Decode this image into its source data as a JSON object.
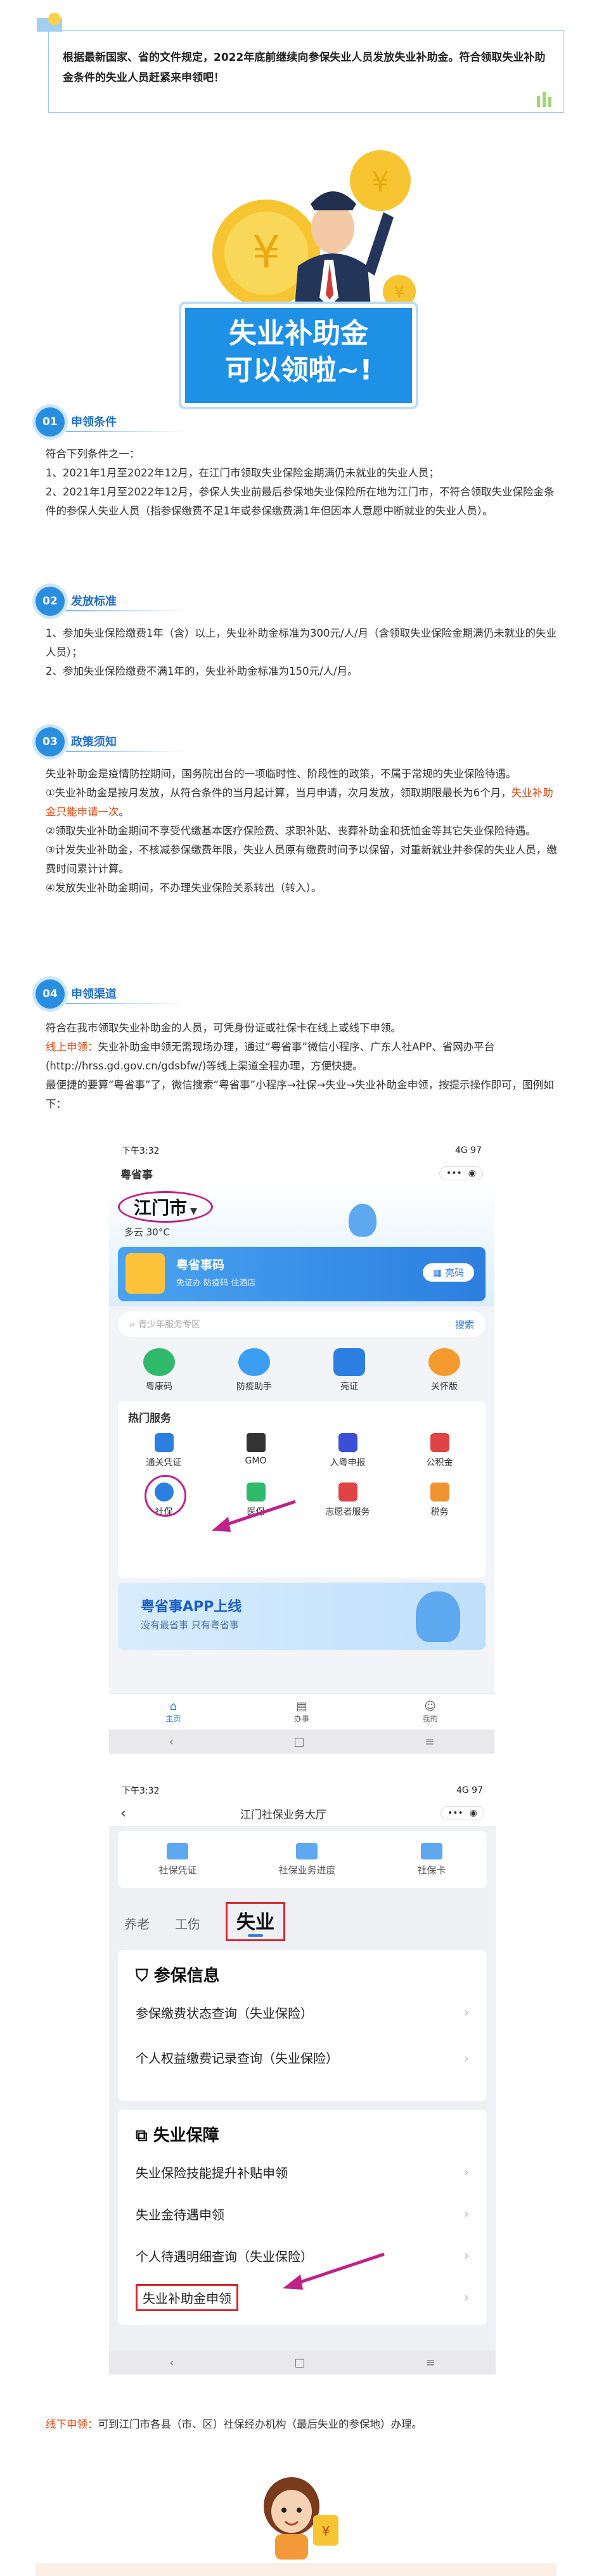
{
  "intro": {
    "text": "根据最新国家、省的文件规定，2022年底前继续向参保失业人员发放失业补助金。符合领取失业补助金条件的失业人员赶紧来申领吧！"
  },
  "hero": {
    "line1": "失业补助金",
    "line2": "可以领啦~!"
  },
  "sections": [
    {
      "num": "01",
      "title": "申领条件",
      "paras": [
        "符合下列条件之一：",
        "1、2021年1月至2022年12月，在江门市领取失业保险金期满仍未就业的失业人员；",
        "2、2021年1月至2022年12月，参保人失业前最后参保地失业保险所在地为江门市，不符合领取失业保险金条件的参保人失业人员（指参保缴费不足1年或参保缴费满1年但因本人意愿中断就业的失业人员）。"
      ]
    },
    {
      "num": "02",
      "title": "发放标准",
      "paras": [
        "1、参加失业保险缴费1年（含）以上，失业补助金标准为300元/人/月（含领取失业保险金期满仍未就业的失业人员）；",
        "2、参加失业保险缴费不满1年的，失业补助金标准为150元/人/月。"
      ]
    },
    {
      "num": "03",
      "title": "政策须知",
      "p1": "失业补助金是疫情防控期间，国务院出台的一项临时性、阶段性的政策，不属于常规的失业保险待遇。",
      "p2a": "①失业补助金是按月发放，从符合条件的当月起计算，当月申请，次月发放，领取期限最长为6个月，",
      "p2hl": "失业补助金只能申请一次",
      "p2b": "。",
      "p3": "②领取失业补助金期间不享受代缴基本医疗保险费、求职补贴、丧葬补助金和抚恤金等其它失业保险待遇。",
      "p4": "③计发失业补助金，不核减参保缴费年限，失业人员原有缴费时间予以保留，对重新就业并参保的失业人员，缴费时间累计计算。",
      "p5": "④发放失业补助金期间，不办理失业保险关系转出（转入）。"
    },
    {
      "num": "04",
      "title": "申领渠道",
      "p1": "符合在我市领取失业补助金的人员，可凭身份证或社保卡在线上或线下申领。",
      "online_label": "线上申领：",
      "online_text": "失业补助金申领无需现场办理，通过“粤省事”微信小程序、广东人社APP、省网办平台(http://hrss.gd.gov.cn/gdsbfw/)等线上渠道全程办理，方便快捷。",
      "p3": "最便捷的要算“粤省事”了，微信搜索“粤省事”小程序→社保→失业→失业补助金申领，按提示操作即可，图例如下：",
      "offline_label": "线下申领：",
      "offline_text": "可到江门市各县（市、区）社保经办机构（最后失业的参保地）办理。"
    }
  ],
  "phone1": {
    "status_time": "下午3:32",
    "status_right": "4G 97",
    "app_name": "粤省事",
    "city": "江门市",
    "weather": "多云 30°C",
    "code_title": "粤省事码",
    "code_sub": "免证办 防疫码 住酒店",
    "code_btn": "亮码",
    "search_placeholder": "青少年服务专区",
    "search_btn": "搜索",
    "top_icons": [
      "粤康码",
      "防疫助手",
      "亮证",
      "关怀版"
    ],
    "hot_title": "热门服务",
    "services_row1": [
      "通关凭证",
      "GMO",
      "入粤申报",
      "公积金"
    ],
    "services_row2": [
      "社保",
      "医保",
      "志愿者服务",
      "税务"
    ],
    "banner_title": "粤省事APP上线",
    "banner_sub": "没有最省事  只有粤省事",
    "tabs": [
      "主页",
      "办事",
      "我的"
    ]
  },
  "phone2": {
    "status_time": "下午3:32",
    "status_right": "4G 97",
    "title": "江门社保业务大厅",
    "quick": [
      "社保凭证",
      "社保业务进度",
      "社保卡"
    ],
    "tabs": [
      "养老",
      "工伤",
      "失业"
    ],
    "group1_title": "参保信息",
    "group1_rows": [
      "参保缴费状态查询（失业保险）",
      "个人权益缴费记录查询（失业保险）"
    ],
    "group2_title": "失业保障",
    "group2_rows": [
      "失业保险技能提升补贴申领",
      "失业金待遇申领",
      "个人待遇明细查询（失业保险）",
      "失业补助金申领"
    ]
  },
  "colors": {
    "accent": "#2a8ee0",
    "highlight": "#e8420b",
    "hero_box": "#1e90e6"
  }
}
